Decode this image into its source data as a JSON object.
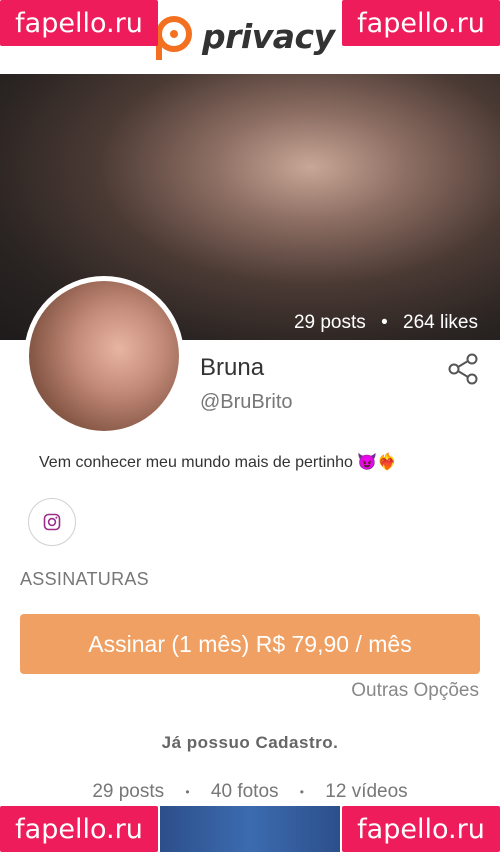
{
  "watermark": "fapello.ru",
  "brand": {
    "name": "privacy",
    "accent": "#f37021",
    "text_color": "#333333"
  },
  "cover": {
    "posts": "29 posts",
    "separator": "•",
    "likes": "264 likes"
  },
  "profile": {
    "name": "Bruna",
    "handle": "@BruBrito",
    "bio": "Vem conhecer meu mundo mais de pertinho 😈❤️‍🔥"
  },
  "social": {
    "icon": "instagram-icon"
  },
  "subscriptions": {
    "title": "ASSINATURAS",
    "button_label": "Assinar (1 mês)  R$ 79,90 / mês",
    "button_color": "#efa062",
    "other_options": "Outras Opções"
  },
  "login_text": "Já possuo Cadastro.",
  "counts": {
    "posts": "29 posts",
    "photos": "40 fotos",
    "videos": "12 vídeos",
    "separator": "•"
  },
  "watermark_color": "#ee1c5a"
}
